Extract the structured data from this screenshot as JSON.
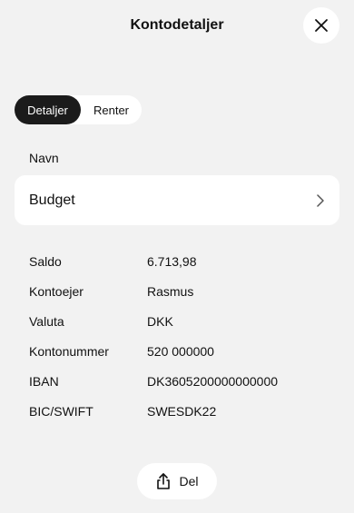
{
  "header": {
    "title": "Kontodetaljer",
    "close_icon": "close-icon"
  },
  "tabs": [
    {
      "label": "Detaljer",
      "active": true
    },
    {
      "label": "Renter",
      "active": false
    }
  ],
  "name_section": {
    "label": "Navn",
    "value": "Budget",
    "chevron_icon": "chevron-right-icon"
  },
  "details": [
    {
      "label": "Saldo",
      "value": "6.713,98"
    },
    {
      "label": "Kontoejer",
      "value": "Rasmus"
    },
    {
      "label": "Valuta",
      "value": "DKK"
    },
    {
      "label": "Kontonummer",
      "value": "520 000000"
    },
    {
      "label": "IBAN",
      "value": "DK3605200000000000"
    },
    {
      "label": "BIC/SWIFT",
      "value": "SWESDK22"
    }
  ],
  "share": {
    "label": "Del",
    "icon": "share-icon"
  },
  "colors": {
    "background": "#f2f2f2",
    "card": "#ffffff",
    "active_tab": "#1b1b1b"
  }
}
